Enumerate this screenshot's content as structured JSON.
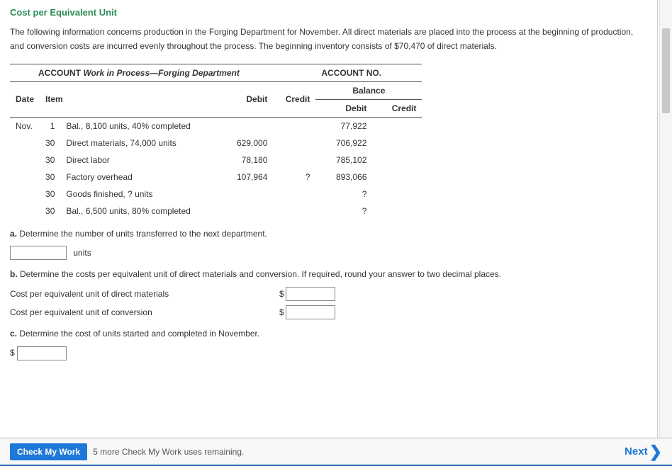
{
  "heading": "Cost per Equivalent Unit",
  "intro": "The following information concerns production in the Forging Department for November. All direct materials are placed into the process at the beginning of production, and conversion costs are incurred evenly throughout the process. The beginning inventory consists of $70,470 of direct materials.",
  "account": {
    "title_left": "ACCOUNT",
    "title_italic": "Work in Process—Forging Department",
    "title_right": "ACCOUNT NO.",
    "cols": {
      "date": "Date",
      "item": "Item",
      "debit": "Debit",
      "credit": "Credit",
      "balance": "Balance",
      "bal_debit": "Debit",
      "bal_credit": "Credit"
    },
    "rows": [
      {
        "date": "Nov.",
        "day": "1",
        "item": "Bal., 8,100 units, 40% completed",
        "debit": "",
        "credit": "",
        "bdebit": "77,922",
        "bcredit": ""
      },
      {
        "date": "",
        "day": "30",
        "item": "Direct materials, 74,000 units",
        "debit": "629,000",
        "credit": "",
        "bdebit": "706,922",
        "bcredit": ""
      },
      {
        "date": "",
        "day": "30",
        "item": "Direct labor",
        "debit": "78,180",
        "credit": "",
        "bdebit": "785,102",
        "bcredit": ""
      },
      {
        "date": "",
        "day": "30",
        "item": "Factory overhead",
        "debit": "107,964",
        "credit": "?",
        "bdebit": "893,066",
        "bcredit": ""
      },
      {
        "date": "",
        "day": "30",
        "item": "Goods finished, ? units",
        "debit": "",
        "credit": "",
        "bdebit": "?",
        "bcredit": ""
      },
      {
        "date": "",
        "day": "30",
        "item": "Bal., 6,500 units, 80% completed",
        "debit": "",
        "credit": "",
        "bdebit": "?",
        "bcredit": ""
      }
    ]
  },
  "partA": {
    "label_bold": "a.",
    "text": "  Determine the number of units transferred to the next department.",
    "units_label": "units"
  },
  "partB": {
    "label_bold": "b.",
    "text": "  Determine the costs per equivalent unit of direct materials and conversion. If required, round your answer to two decimal places.",
    "row1_label": "Cost per equivalent unit of direct materials",
    "row2_label": "Cost per equivalent unit of conversion",
    "dollar": "$"
  },
  "partC": {
    "label_bold": "c.",
    "text": " Determine the cost of units started and completed in November.",
    "dollar": "$"
  },
  "footer": {
    "check_label": "Check My Work",
    "remaining": "5 more Check My Work uses remaining.",
    "next_label": "Next"
  }
}
